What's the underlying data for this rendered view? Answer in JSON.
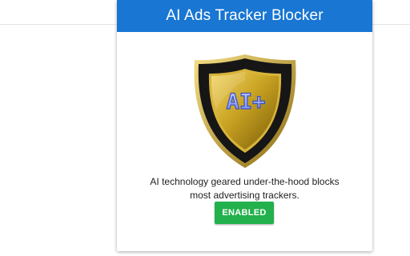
{
  "popup": {
    "title": "AI Ads Tracker Blocker",
    "logo_text": "AI+",
    "logo_icon": "shield-icon",
    "description_line1": "AI technology geared under-the-hood blocks",
    "description_line2": "most advertising trackers.",
    "status_button_label": "ENABLED"
  },
  "colors": {
    "header_bg": "#1976d2",
    "button_bg": "#22b14c",
    "shield_outer": "#1a1a1a",
    "shield_gold": "#c8a21e",
    "logo_text": "#8fa6ff"
  }
}
